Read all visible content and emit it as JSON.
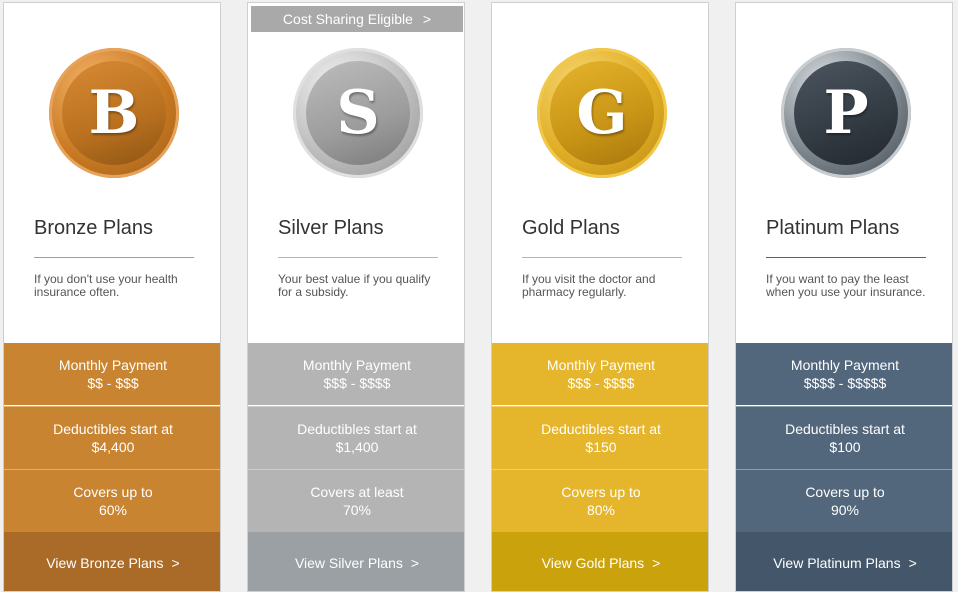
{
  "cost_sharing_banner": {
    "label": "Cost Sharing Eligible",
    "chevron": ">"
  },
  "plans": [
    {
      "letter": "B",
      "title": "Bronze Plans",
      "description": "If you don't use your health insurance often.",
      "monthly_label": "Monthly Payment",
      "monthly_value": "$$ - $$$",
      "deductible_label": "Deductibles start at",
      "deductible_value": "$4,400",
      "covers_label": "Covers up to",
      "covers_value": "60%",
      "cta_label": "View Bronze Plans",
      "cta_chevron": ">",
      "color": "#c98431"
    },
    {
      "letter": "S",
      "title": "Silver Plans",
      "description": "Your best value if you qualify for a subsidy.",
      "monthly_label": "Monthly Payment",
      "monthly_value": "$$$ - $$$$",
      "deductible_label": "Deductibles start at",
      "deductible_value": "$1,400",
      "covers_label": "Covers at least",
      "covers_value": "70%",
      "cta_label": "View Silver Plans",
      "cta_chevron": ">",
      "color": "#b4b4b4"
    },
    {
      "letter": "G",
      "title": "Gold Plans",
      "description": "If you visit the doctor and pharmacy regularly.",
      "monthly_label": "Monthly Payment",
      "monthly_value": "$$$ - $$$$",
      "deductible_label": "Deductibles start at",
      "deductible_value": "$150",
      "covers_label": "Covers up to",
      "covers_value": "80%",
      "cta_label": "View Gold Plans",
      "cta_chevron": ">",
      "color": "#e5b52b"
    },
    {
      "letter": "P",
      "title": "Platinum Plans",
      "description": "If you want to pay the least when you use your insurance.",
      "monthly_label": "Monthly Payment",
      "monthly_value": "$$$$ - $$$$$",
      "deductible_label": "Deductibles start at",
      "deductible_value": "$100",
      "covers_label": "Covers up to",
      "covers_value": "90%",
      "cta_label": "View Platinum Plans",
      "cta_chevron": ">",
      "color": "#52667c"
    }
  ]
}
